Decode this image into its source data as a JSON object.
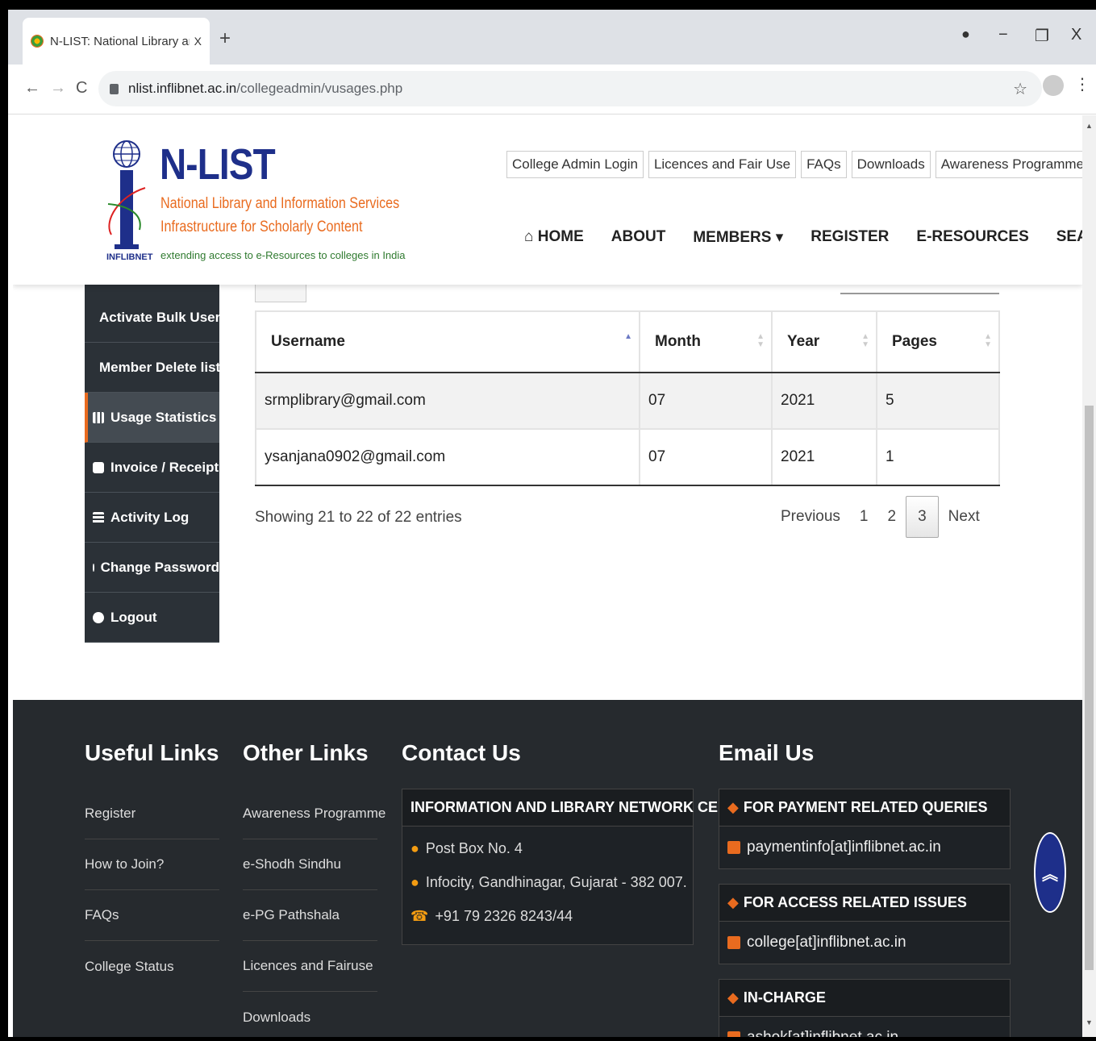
{
  "browser": {
    "tab_title": "N-LIST: National Library and Info",
    "tab_close": "X",
    "new_tab": "+",
    "url_host": "nlist.inflibnet.ac.in",
    "url_path": "/collegeadmin/vusages.php",
    "back": "←",
    "forward": "→",
    "reload": "C",
    "star": "☆",
    "menu": "⋮",
    "minimize": "−",
    "restore": "❐",
    "close": "X"
  },
  "header": {
    "logo_title": "N-LIST",
    "logo_sub1": "National Library and Information Services",
    "logo_sub2": "Infrastructure for Scholarly Content",
    "logo_tagline": "extending access to e-Resources to colleges in India",
    "logo_brand": "INFLIBNET",
    "top_links": [
      "College Admin Login",
      "Licences and Fair Use",
      "FAQs",
      "Downloads",
      "Awareness Programme"
    ],
    "nav": [
      "HOME",
      "ABOUT",
      "MEMBERS ▾",
      "REGISTER",
      "E-RESOURCES",
      "SEARCH"
    ]
  },
  "sidebar": {
    "items": [
      {
        "label": "Activate Bulk Users",
        "icon": "check-square-icon"
      },
      {
        "label": "Member Delete list",
        "icon": "trash-icon"
      },
      {
        "label": "Usage Statistics",
        "icon": "bar-chart-icon"
      },
      {
        "label": "Invoice / Receipt",
        "icon": "printer-icon"
      },
      {
        "label": "Activity Log",
        "icon": "list-icon"
      },
      {
        "label": "Change Password",
        "icon": "key-icon"
      },
      {
        "label": "Logout",
        "icon": "logout-icon"
      }
    ],
    "active_index": 2
  },
  "table": {
    "columns": [
      "Username",
      "Month",
      "Year",
      "Pages"
    ],
    "rows": [
      [
        "srmplibrary@gmail.com",
        "07",
        "2021",
        "5"
      ],
      [
        "ysanjana0902@gmail.com",
        "07",
        "2021",
        "1"
      ]
    ],
    "info": "Showing 21 to 22 of 22 entries",
    "pager": {
      "previous": "Previous",
      "pages": [
        "1",
        "2",
        "3"
      ],
      "current": "3",
      "next": "Next"
    }
  },
  "footer": {
    "useful_links": {
      "title": "Useful Links",
      "items": [
        "Register",
        "How to Join?",
        "FAQs",
        "College Status"
      ]
    },
    "other_links": {
      "title": "Other Links",
      "items": [
        "Awareness Programme",
        "e-Shodh Sindhu",
        "e-PG Pathshala",
        "Licences and Fairuse",
        "Downloads"
      ]
    },
    "contact": {
      "title": "Contact Us",
      "org": "INFORMATION AND LIBRARY NETWORK CENTRE",
      "address1": "Post Box No. 4",
      "address2": "Infocity, Gandhinagar, Gujarat - 382 007.",
      "phone": "+91 79 2326 8243/44"
    },
    "email": {
      "title": "Email Us",
      "groups": [
        {
          "heading": "FOR PAYMENT RELATED QUERIES",
          "address": "paymentinfo[at]inflibnet.ac.in"
        },
        {
          "heading": "FOR ACCESS RELATED ISSUES",
          "address": "college[at]inflibnet.ac.in"
        },
        {
          "heading": "IN-CHARGE",
          "address": "ashok[at]inflibnet.ac.in"
        }
      ]
    }
  },
  "colors": {
    "brand_blue": "#1e2f8a",
    "brand_orange": "#e96b1f",
    "footer_bg": "#262a2e",
    "sidebar_bg": "#2b3137"
  }
}
